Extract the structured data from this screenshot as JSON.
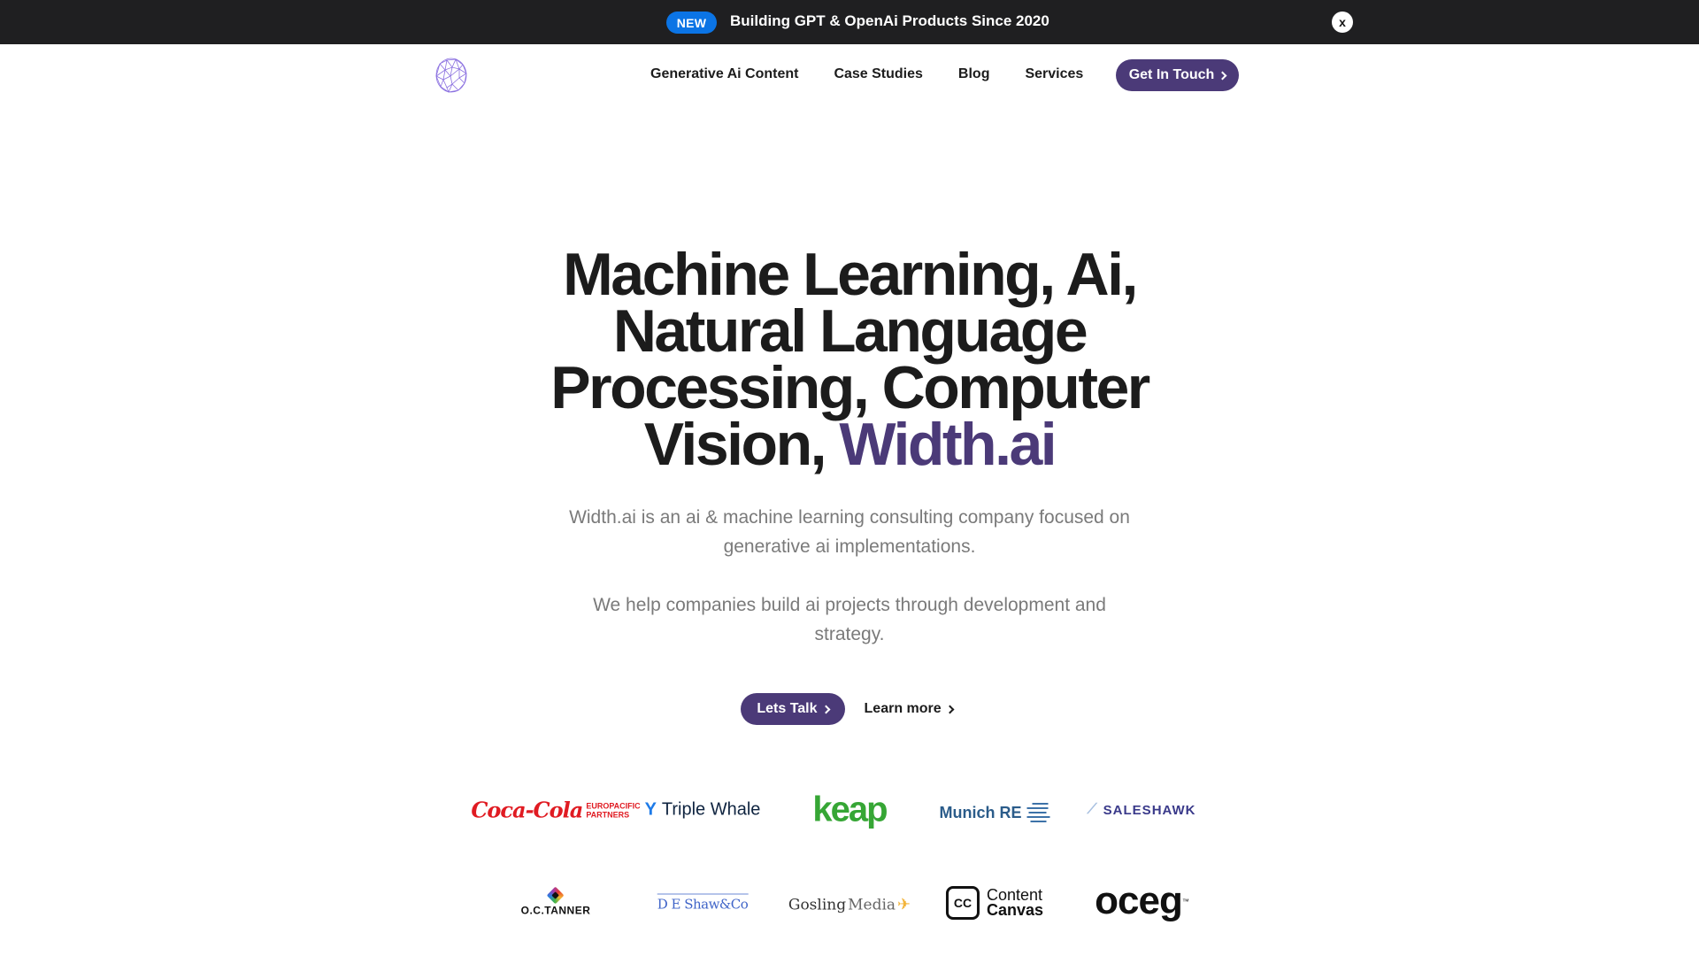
{
  "banner": {
    "badge": "NEW",
    "message": "Building GPT & OpenAi Products Since 2020",
    "close_label": "x",
    "colors": {
      "background": "#1f1f21",
      "badge": "#0b74e5"
    }
  },
  "nav": {
    "logo_icon": "geodesic-sphere-logo",
    "links": [
      {
        "label": "Generative Ai Content"
      },
      {
        "label": "Case Studies"
      },
      {
        "label": "Blog"
      },
      {
        "label": "Services"
      }
    ],
    "cta_label": "Get In Touch"
  },
  "hero": {
    "headline_main": "Machine Learning, Ai, Natural Language Processing, Computer Vision, ",
    "headline_accent": "Width.ai",
    "paragraph_1": "Width.ai is an ai & machine learning consulting company focused on generative ai implementations.",
    "paragraph_2": "We help companies build ai projects through development and strategy.",
    "primary_button": "Lets Talk",
    "secondary_button": "Learn more",
    "accent_color": "#4b3a78"
  },
  "clients": {
    "row_1": [
      {
        "name": "Coca-Cola Europacific Partners",
        "script": "Coca-Cola",
        "tag_line_1": "EUROPACIFIC",
        "tag_line_2": "PARTNERS"
      },
      {
        "name": "Triple Whale",
        "text": "Triple Whale"
      },
      {
        "name": "keap",
        "text": "keap"
      },
      {
        "name": "Munich RE",
        "text": "Munich RE"
      },
      {
        "name": "Saleshawk",
        "text": "SALESHAWK"
      }
    ],
    "row_2": [
      {
        "name": "O.C. Tanner",
        "text": "O.C.TANNER"
      },
      {
        "name": "D E Shaw & Co",
        "text": "D E Shaw&Co"
      },
      {
        "name": "Gosling Media",
        "text_bold": "Gosling",
        "text_light": "Media"
      },
      {
        "name": "Content Canvas",
        "mark": "CC",
        "line_1": "Content",
        "line_2": "Canvas"
      },
      {
        "name": "oceg",
        "text": "oceg",
        "tm": "™"
      }
    ]
  }
}
